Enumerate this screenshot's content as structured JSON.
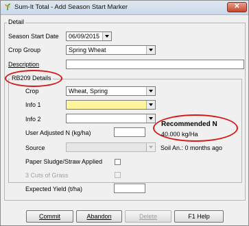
{
  "window": {
    "title": "Sum-It Total - Add Season Start Marker",
    "close_glyph": "✕"
  },
  "detail": {
    "legend": "Detail",
    "season_start_date_label": "Season Start Date",
    "season_start_date_value": "06/09/2015",
    "crop_group_label": "Crop Group",
    "crop_group_value": "Spring Wheat",
    "description_label": "Description",
    "description_value": ""
  },
  "rb209": {
    "legend": "RB209 Details",
    "crop_label": "Crop",
    "crop_value": "Wheat, Spring",
    "info1_label": "Info 1",
    "info1_value": "",
    "info2_label": "Info 2",
    "info2_value": "",
    "user_adjusted_n_label": "User Adjusted N (kg/ha)",
    "user_adjusted_n_value": "",
    "recommended_n_title": "Recommended N",
    "recommended_n_value": "40.000 kg/Ha",
    "source_label": "Source",
    "source_value": "",
    "soil_an_text": "Soil An.: 0 months ago",
    "paper_sludge_label": "Paper Sludge/Straw Applied",
    "three_cuts_label": "3 Cuts of Grass",
    "expected_yield_label": "Expected Yield (t/ha)",
    "expected_yield_value": ""
  },
  "buttons": {
    "commit": "Commit",
    "abandon": "Abandon",
    "delete": "Delete",
    "help": "F1 Help"
  },
  "colors": {
    "highlight_ellipse": "#d81818",
    "info1_fill": "#fff59d"
  }
}
